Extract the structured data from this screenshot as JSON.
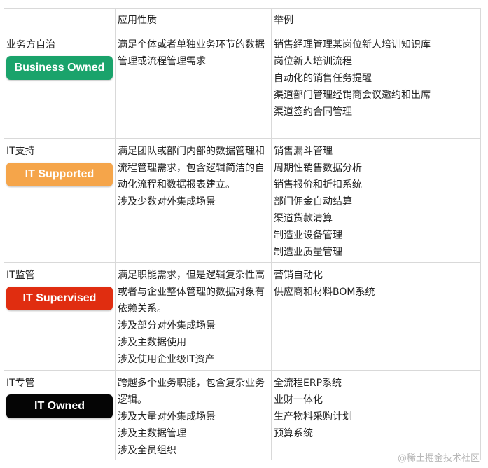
{
  "header": {
    "col1": "",
    "col2": "应用性质",
    "col3": "举例"
  },
  "rows": [
    {
      "category": "业务方自治",
      "badge": "Business Owned",
      "badge_color": "#1aa36b",
      "nature": [
        "满足个体或者单独业务环节的数据管理或流程管理需求"
      ],
      "examples": [
        "销售经理管理某岗位新人培训知识库",
        "岗位新人培训流程",
        "自动化的销售任务提醒",
        "渠道部门管理经销商会议邀约和出席",
        "渠道签约合同管理"
      ]
    },
    {
      "category": "IT支持",
      "badge": "IT Supported",
      "badge_color": "#f5a54a",
      "nature": [
        "满足团队或部门内部的数据管理和流程管理需求，包含逻辑简洁的自动化流程和数据报表建立。",
        "涉及少数对外集成场景"
      ],
      "examples": [
        "销售漏斗管理",
        "周期性销售数据分析",
        "销售报价和折扣系统",
        "部门佣金自动结算",
        "渠道货款清算",
        "制造业设备管理",
        "制造业质量管理"
      ]
    },
    {
      "category": "IT监管",
      "badge": "IT Supervised",
      "badge_color": "#e02d10",
      "nature": [
        "满足职能需求，但是逻辑复杂性高或者与企业整体管理的数据对象有依赖关系。",
        "涉及部分对外集成场景",
        "涉及主数据使用",
        "涉及使用企业级IT资产"
      ],
      "examples": [
        "营销自动化",
        "供应商和材料BOM系统"
      ]
    },
    {
      "category": "IT专管",
      "badge": "IT Owned",
      "badge_color": "#050505",
      "nature": [
        "跨越多个业务职能，包含复杂业务逻辑。",
        "涉及大量对外集成场景",
        "涉及主数据管理",
        "涉及全员组织"
      ],
      "examples": [
        "全流程ERP系统",
        "业财一体化",
        "生产物料采购计划",
        "预算系统"
      ]
    }
  ],
  "watermark": "@稀土掘金技术社区"
}
